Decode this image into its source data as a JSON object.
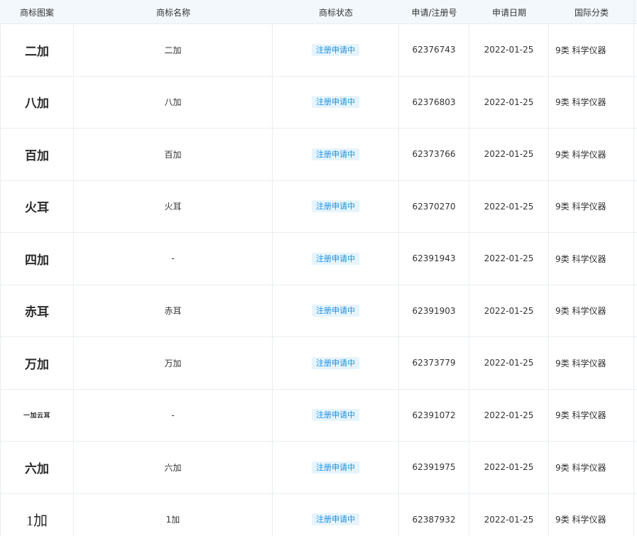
{
  "headers": [
    "商标图案",
    "商标名称",
    "商标状态",
    "申请/注册号",
    "申请日期",
    "国际分类"
  ],
  "rows": [
    {
      "mark": "二加",
      "name": "二加",
      "status": "注册申请中",
      "reg_no": "62376743",
      "date": "2022-01-25",
      "class": "9类 科学仪器"
    },
    {
      "mark": "八加",
      "name": "八加",
      "status": "注册申请中",
      "reg_no": "62376803",
      "date": "2022-01-25",
      "class": "9类 科学仪器"
    },
    {
      "mark": "百加",
      "name": "百加",
      "status": "注册申请中",
      "reg_no": "62373766",
      "date": "2022-01-25",
      "class": "9类 科学仪器"
    },
    {
      "mark": "火耳",
      "name": "火耳",
      "status": "注册申请中",
      "reg_no": "62370270",
      "date": "2022-01-25",
      "class": "9类 科学仪器"
    },
    {
      "mark": "四加",
      "name": "-",
      "status": "注册申请中",
      "reg_no": "62391943",
      "date": "2022-01-25",
      "class": "9类 科学仪器"
    },
    {
      "mark": "赤耳",
      "name": "赤耳",
      "status": "注册申请中",
      "reg_no": "62391903",
      "date": "2022-01-25",
      "class": "9类 科学仪器"
    },
    {
      "mark": "万加",
      "name": "万加",
      "status": "注册申请中",
      "reg_no": "62373779",
      "date": "2022-01-25",
      "class": "9类 科学仪器"
    },
    {
      "mark": "一加云耳",
      "name": "-",
      "status": "注册申请中",
      "reg_no": "62391072",
      "date": "2022-01-25",
      "class": "9类 科学仪器"
    },
    {
      "mark": "六加",
      "name": "六加",
      "status": "注册申请中",
      "reg_no": "62391975",
      "date": "2022-01-25",
      "class": "9类 科学仪器"
    },
    {
      "mark": "1加",
      "name": "1加",
      "status": "注册申请中",
      "reg_no": "62387932",
      "date": "2022-01-25",
      "class": "9类 科学仪器"
    }
  ],
  "colors": {
    "header_bg": "#f2f8fc",
    "badge_bg": "#e6f4fd",
    "badge_text": "#1a8fe0",
    "border": "#e9eef2"
  }
}
